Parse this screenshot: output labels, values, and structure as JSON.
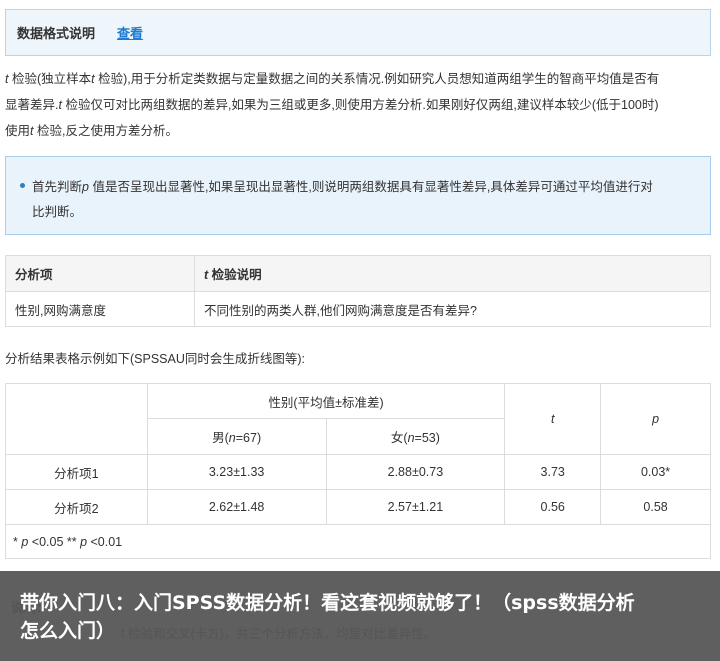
{
  "header": {
    "title": "数据格式说明",
    "view_link": "查看"
  },
  "intro": {
    "line1_t": "t",
    "line1_a": " 检验(独立样本",
    "line1_t2": "t",
    "line1_b": " 检验),用于分析定类数据与定量数据之间的关系情况.例如研究人员想知道两组学生的智商平均值是否有",
    "line2_a": "显著差异.",
    "line2_t": "t",
    "line2_b": " 检验仅可对比两组数据的差异,如果为三组或更多,则使用方差分析.如果刚好仅两组,建议样本较少(低于100时)",
    "line3_a": "使用",
    "line3_t": "t",
    "line3_b": " 检验,反之使用方差分析。"
  },
  "tip": {
    "text_a": "首先判断",
    "p": "p",
    "text_b": " 值是否呈现出显著性,如果呈现出显著性,则说明两组数据具有显著性差异,具体差异可通过平均值进行对",
    "text_c": "比判断。"
  },
  "desc_table": {
    "col1_header": "分析项",
    "col2_header_t": "t",
    "col2_header": " 检验说明",
    "row_item": "性别,网购满意度",
    "row_desc": "不同性别的两类人群,他们网购满意度是否有差异?"
  },
  "example_label": "分析结果表格示例如下(SPSSAU同时会生成折线图等):",
  "result_table": {
    "group_header": "性别(平均值±标准差)",
    "male_a": "男(",
    "male_n": "n",
    "male_b": "=67)",
    "female_a": "女(",
    "female_n": "n",
    "female_b": "=53)",
    "t_header": "t",
    "p_header": "p",
    "rows": [
      {
        "item": "分析项1",
        "male": "3.23±1.33",
        "female": "2.88±0.73",
        "t": "3.73",
        "p": "0.03*"
      },
      {
        "item": "分析项2",
        "male": "2.62±1.48",
        "female": "2.57±1.21",
        "t": "0.56",
        "p": "0.58"
      }
    ],
    "note_a": "* ",
    "note_p1": "p",
    "note_b": " <0.05 ** ",
    "note_p2": "p",
    "note_c": " <0.01"
  },
  "overlay": {
    "under_label": "说明：",
    "under_text": "t 检验和交叉(卡方)，共三个分析方法，均是对比差异性。",
    "title": "带你入门八：入门SPSS数据分析！看这套视频就够了！（spss数据分析怎么入门）"
  }
}
